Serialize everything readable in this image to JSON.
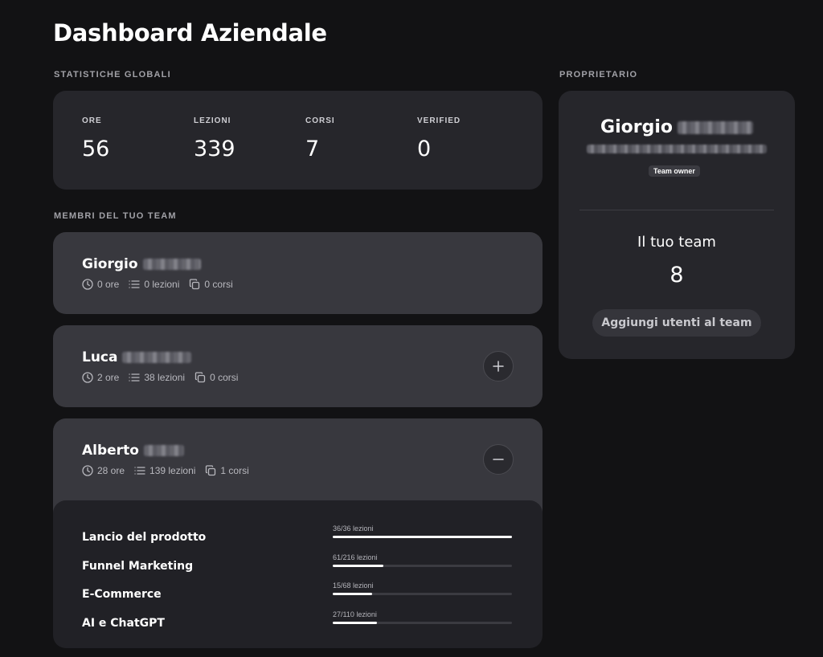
{
  "page": {
    "title": "Dashboard Aziendale"
  },
  "stats": {
    "section_label": "STATISTICHE GLOBALI",
    "items": [
      {
        "label": "ORE",
        "value": "56"
      },
      {
        "label": "LEZIONI",
        "value": "339"
      },
      {
        "label": "CORSI",
        "value": "7"
      },
      {
        "label": "VERIFIED",
        "value": "0"
      }
    ]
  },
  "members": {
    "section_label": "MEMBRI DEL TUO TEAM",
    "items": [
      {
        "name": "Giorgio",
        "hours": "0 ore",
        "lessons": "0 lezioni",
        "courses": "0 corsi"
      },
      {
        "name": "Luca",
        "hours": "2 ore",
        "lessons": "38 lezioni",
        "courses": "0 corsi",
        "toggle": "+"
      },
      {
        "name": "Alberto",
        "hours": "28 ore",
        "lessons": "139 lezioni",
        "courses": "1 corsi",
        "toggle": "−"
      }
    ],
    "expanded_courses": [
      {
        "name": "Lancio del prodotto",
        "progress": "36/36 lezioni",
        "fraction": 1.0
      },
      {
        "name": "Funnel Marketing",
        "progress": "61/216 lezioni",
        "fraction": 0.282
      },
      {
        "name": "E-Commerce",
        "progress": "15/68 lezioni",
        "fraction": 0.221
      },
      {
        "name": "AI e ChatGPT",
        "progress": "27/110 lezioni",
        "fraction": 0.245
      }
    ]
  },
  "owner": {
    "section_label": "PROPRIETARIO",
    "name": "Giorgio",
    "badge": "Team owner",
    "team_label": "Il tuo team",
    "team_count": "8",
    "add_button": "Aggiungi utenti al team"
  },
  "icons": {
    "hours": "clock-icon",
    "lessons": "list-icon",
    "courses": "copy-icon",
    "expand": "plus-icon",
    "collapse": "minus-icon"
  },
  "colors": {
    "background": "#121214",
    "card": "#26262b",
    "member_card": "#38383e",
    "progress_fill": "#ffffff"
  }
}
